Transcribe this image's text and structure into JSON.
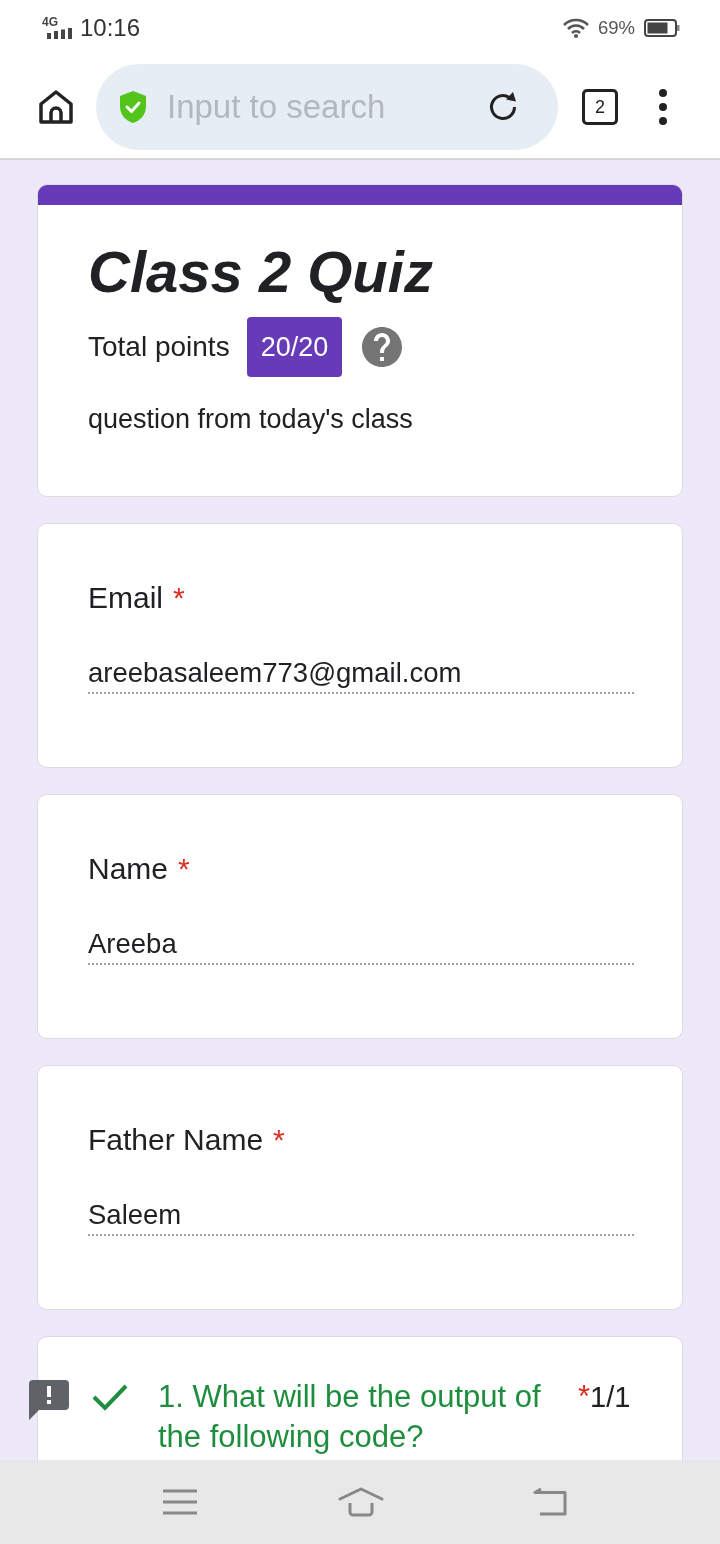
{
  "status_bar": {
    "network": "4G",
    "time": "10:16",
    "battery": "69%"
  },
  "browser_toolbar": {
    "search": {
      "placeholder": "Input to search"
    },
    "tab_count": "2"
  },
  "form_header": {
    "title": "Class 2 Quiz",
    "points_label": "Total points",
    "points": "20/20",
    "description": "question from today's class"
  },
  "fields": [
    {
      "label": "Email",
      "required_mark": "*",
      "value": "areebasaleem773@gmail.com"
    },
    {
      "label": "Name",
      "required_mark": "*",
      "value": "Areeba"
    },
    {
      "label": "Father Name",
      "required_mark": "*",
      "value": "Saleem"
    }
  ],
  "questions": [
    {
      "text": "1. What will be the output of the following code?",
      "required_mark": "*",
      "score": "1/1",
      "correct": true
    }
  ]
}
